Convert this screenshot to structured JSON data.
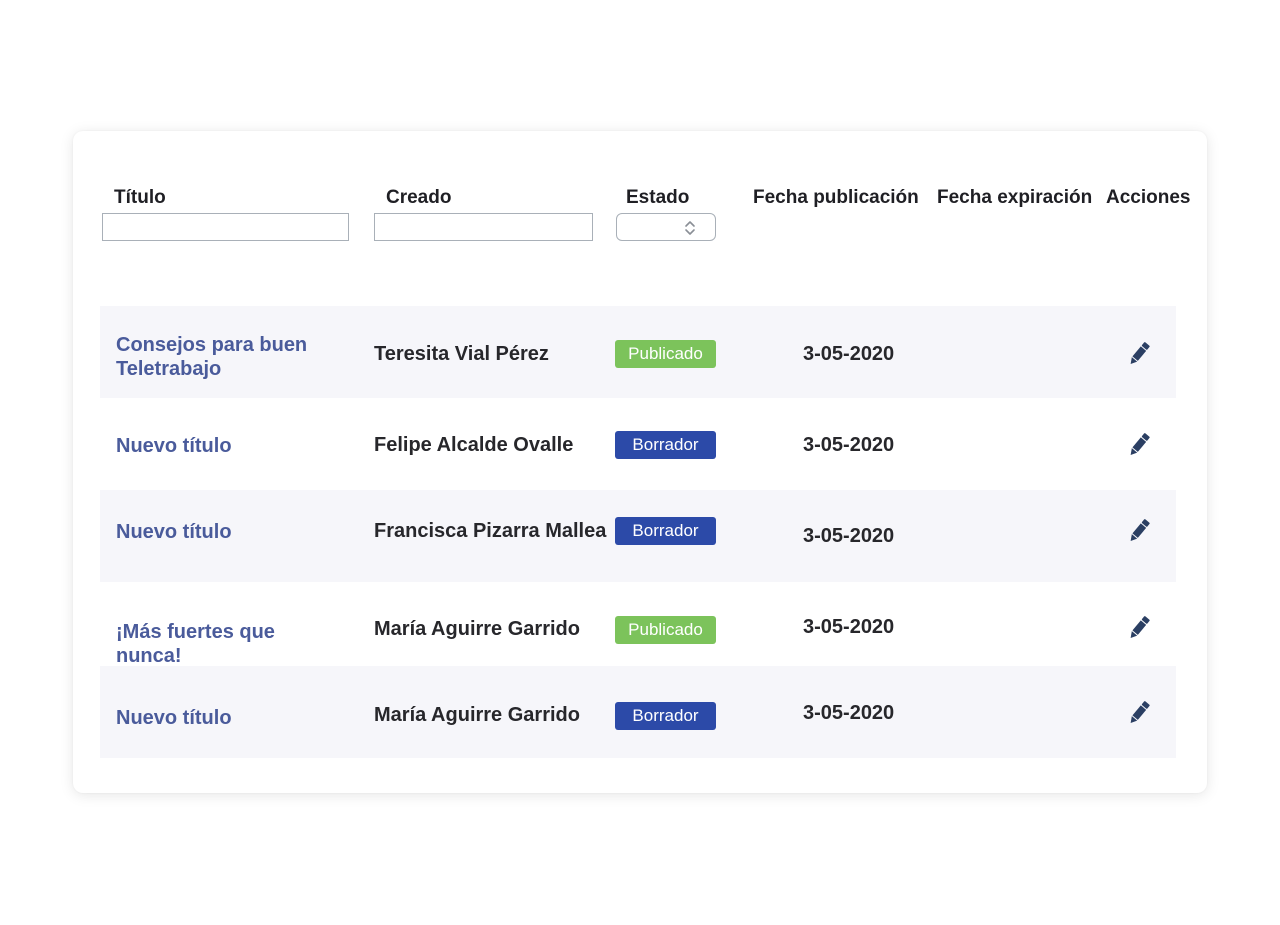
{
  "columns": {
    "title": "Título",
    "created": "Creado",
    "status": "Estado",
    "pub_date": "Fecha publicación",
    "exp_date": "Fecha expiración",
    "actions": "Acciones"
  },
  "filters": {
    "title_value": "",
    "created_value": "",
    "status_value": ""
  },
  "colors": {
    "title_link": "#4a5b9b",
    "badge_published": "#7cc35b",
    "badge_draft": "#2c4aa8",
    "row_shade": "#f6f6fa"
  },
  "rows": [
    {
      "title": "Consejos para buen Teletrabajo",
      "author": "Teresita Vial Pérez",
      "status": "Publicado",
      "status_kind": "published",
      "pub_date": "3-05-2020",
      "exp_date": "",
      "action_icon": "pencil-icon"
    },
    {
      "title": "Nuevo título",
      "author": "Felipe Alcalde Ovalle",
      "status": "Borrador",
      "status_kind": "draft",
      "pub_date": "3-05-2020",
      "exp_date": "",
      "action_icon": "pencil-icon"
    },
    {
      "title": "Nuevo título",
      "author": "Francisca Pizarra Mallea",
      "status": "Borrador",
      "status_kind": "draft",
      "pub_date": "3-05-2020",
      "exp_date": "",
      "action_icon": "pencil-icon"
    },
    {
      "title": "¡Más fuertes que nunca!",
      "author": "María Aguirre Garrido",
      "status": "Publicado",
      "status_kind": "published",
      "pub_date": "3-05-2020",
      "exp_date": "",
      "action_icon": "pencil-icon"
    },
    {
      "title": "Nuevo título",
      "author": "María Aguirre Garrido",
      "status": "Borrador",
      "status_kind": "draft",
      "pub_date": "3-05-2020",
      "exp_date": "",
      "action_icon": "pencil-icon"
    }
  ]
}
